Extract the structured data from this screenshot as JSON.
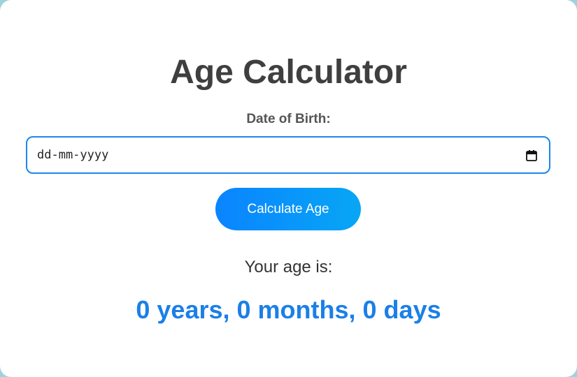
{
  "app": {
    "title": "Age Calculator"
  },
  "form": {
    "dob_label": "Date of Birth:",
    "dob_placeholder": "dd-mm-yyyy",
    "dob_value": "",
    "calculate_label": "Calculate Age"
  },
  "result": {
    "label": "Your age is:",
    "value": "0 years, 0 months, 0 days"
  },
  "icons": {
    "date_picker": "calendar-icon"
  },
  "colors": {
    "accent": "#1b86ee",
    "button_start": "#0a84ff",
    "button_end": "#08a6f5",
    "result_text": "#1b7fe8",
    "title_text": "#3f3f3f",
    "background": "#9fd3dc"
  }
}
